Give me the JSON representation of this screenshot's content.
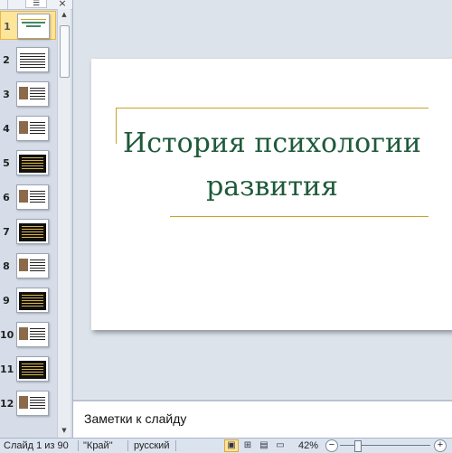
{
  "pane": {
    "tab_slides_icon": "slides-tab-icon",
    "tab_outline_icon": "outline-tab-icon",
    "close_label": "×",
    "slides": [
      {
        "num": "1",
        "selected": true,
        "kind": "title"
      },
      {
        "num": "2",
        "kind": "text"
      },
      {
        "num": "3",
        "kind": "image-text"
      },
      {
        "num": "4",
        "kind": "image-text"
      },
      {
        "num": "5",
        "kind": "dark"
      },
      {
        "num": "6",
        "kind": "image-text"
      },
      {
        "num": "7",
        "kind": "dark"
      },
      {
        "num": "8",
        "kind": "image-text"
      },
      {
        "num": "9",
        "kind": "dark"
      },
      {
        "num": "10",
        "kind": "image-text"
      },
      {
        "num": "11",
        "kind": "dark"
      },
      {
        "num": "12",
        "kind": "image-text"
      }
    ]
  },
  "slide": {
    "title": "История психологии развития",
    "title_color": "#1e5a3a",
    "accent_color": "#c9a227"
  },
  "notes": {
    "placeholder": "Заметки к слайду"
  },
  "status": {
    "slide_info": "Слайд 1 из 90",
    "theme": "\"Край\"",
    "language": "русский",
    "zoom": "42%",
    "zoom_minus": "−",
    "zoom_plus": "+",
    "zoom_level": 0.42
  }
}
